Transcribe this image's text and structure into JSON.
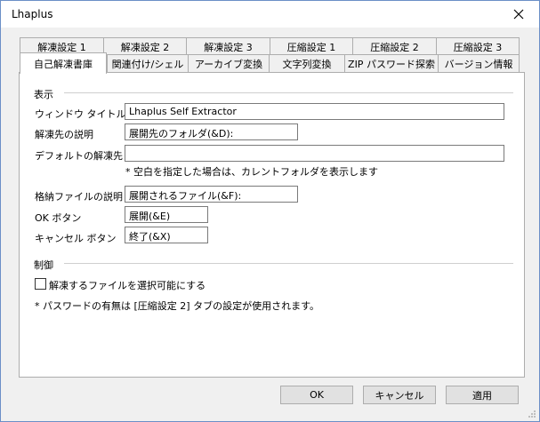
{
  "window": {
    "title": "Lhaplus"
  },
  "tabs_row1": [
    "解凍設定 1",
    "解凍設定 2",
    "解凍設定 3",
    "圧縮設定 1",
    "圧縮設定 2",
    "圧縮設定 3"
  ],
  "tabs_row2": [
    "自己解凍書庫",
    "関連付け/シェル",
    "アーカイブ変換",
    "文字列変換",
    "ZIP パスワード探索",
    "バージョン情報"
  ],
  "display_group": {
    "heading": "表示",
    "window_title_label": "ウィンドウ タイトル",
    "window_title_value": "Lhaplus Self Extractor",
    "extract_desc_label": "解凍先の説明",
    "extract_desc_value": "展開先のフォルダ(&D):",
    "default_dest_label": "デフォルトの解凍先",
    "default_dest_value": "",
    "default_dest_note": "* 空白を指定した場合は、カレントフォルダを表示します",
    "stored_desc_label": "格納ファイルの説明",
    "stored_desc_value": "展開されるファイル(&F):",
    "ok_button_label": "OK ボタン",
    "ok_button_value": "展開(&E)",
    "cancel_button_label": "キャンセル ボタン",
    "cancel_button_value": "終了(&X)"
  },
  "control_group": {
    "heading": "制御",
    "checkbox_label": "解凍するファイルを選択可能にする",
    "checkbox_checked": false,
    "password_note": "* パスワードの有無は [圧縮設定 2] タブの設定が使用されます。"
  },
  "footer": {
    "ok": "OK",
    "cancel": "キャンセル",
    "apply": "適用"
  },
  "colors": {
    "window_border": "#6b8fc7",
    "panel_bg": "#ffffff",
    "dialog_bg": "#f0f0f0"
  }
}
